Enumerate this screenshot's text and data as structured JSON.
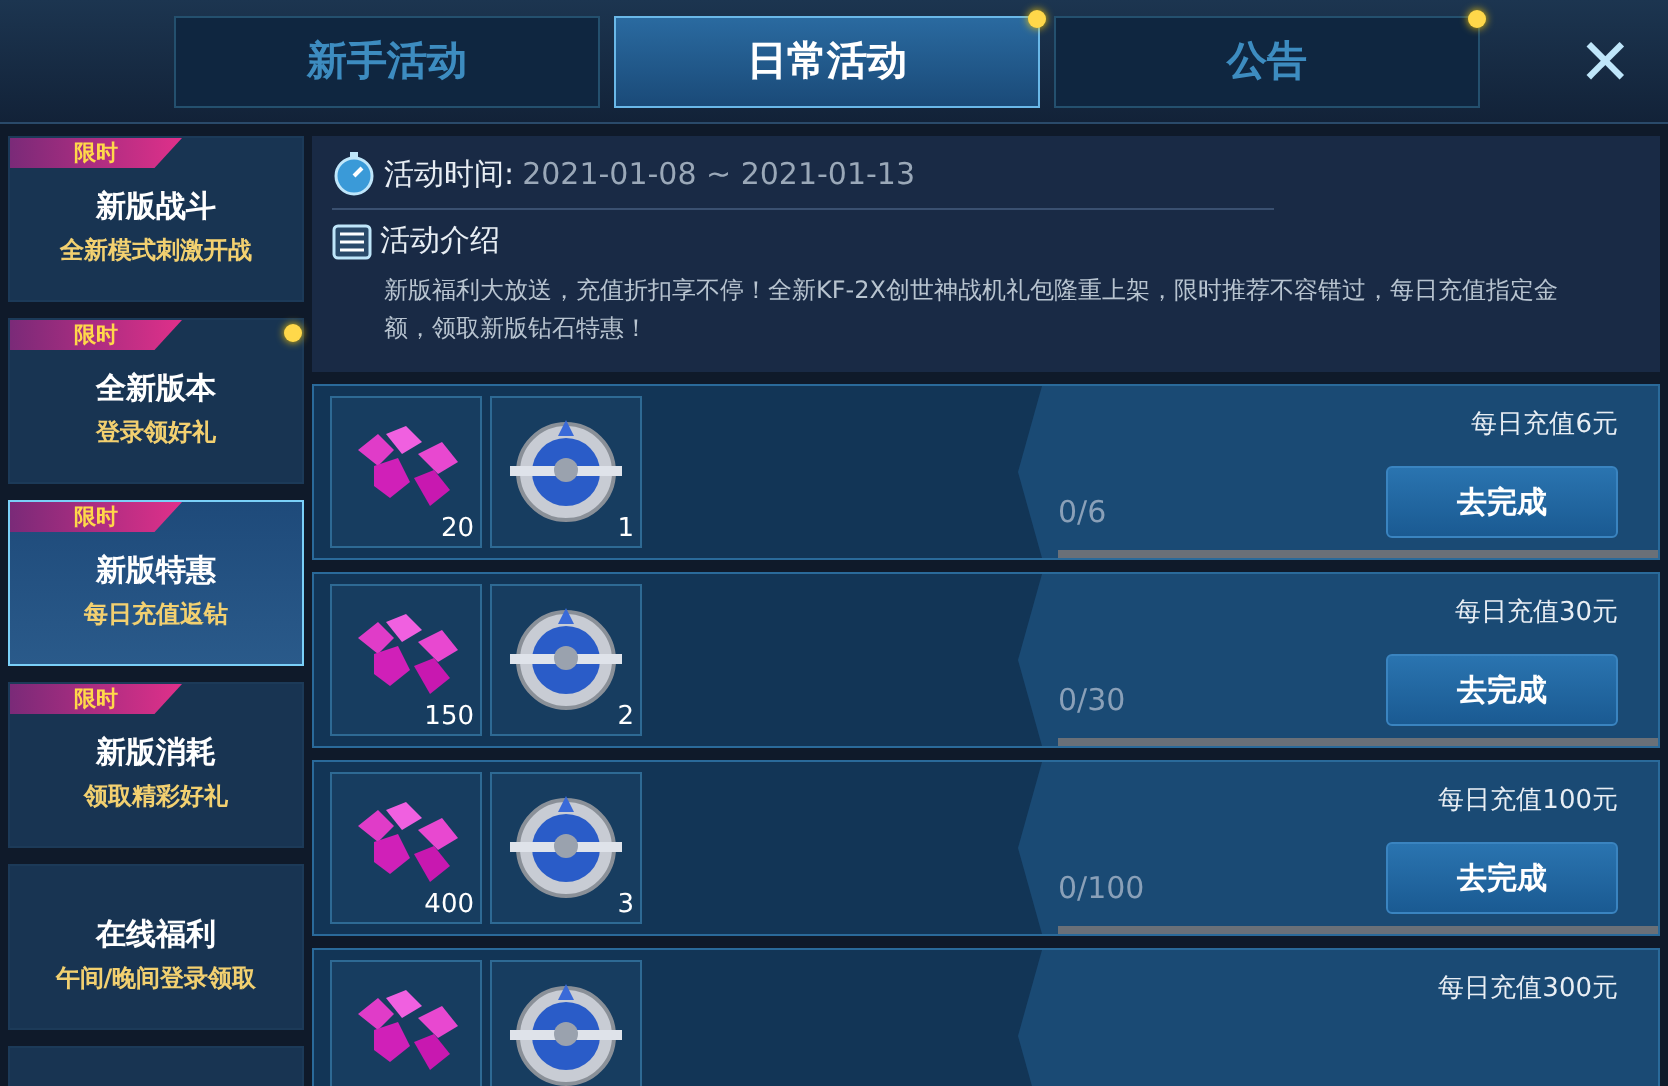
{
  "tabs": [
    {
      "label": "新手活动",
      "selected": false,
      "dot": false
    },
    {
      "label": "日常活动",
      "selected": true,
      "dot": true
    },
    {
      "label": "公告",
      "selected": false,
      "dot": true
    }
  ],
  "close": "✕",
  "sidebar": {
    "items": [
      {
        "title": "新版战斗",
        "subtitle": "全新模式刺激开战",
        "badge": "限时",
        "selected": false,
        "dot": false
      },
      {
        "title": "全新版本",
        "subtitle": "登录领好礼",
        "badge": "限时",
        "selected": false,
        "dot": true
      },
      {
        "title": "新版特惠",
        "subtitle": "每日充值返钻",
        "badge": "限时",
        "selected": true,
        "dot": false
      },
      {
        "title": "新版消耗",
        "subtitle": "领取精彩好礼",
        "badge": "限时",
        "selected": false,
        "dot": false
      },
      {
        "title": "在线福利",
        "subtitle": "午间/晚间登录领取",
        "selected": false,
        "dot": false
      }
    ]
  },
  "activity": {
    "time_label": "活动时间:",
    "time_value": "2021-01-08 ~ 2021-01-13",
    "intro_title": "活动介绍",
    "intro_text": "新版福利大放送，充值折扣享不停！全新KF-2X创世神战机礼包隆重上架，限时推荐不容错过，每日充值指定金额，领取新版钻石特惠！"
  },
  "tasks": [
    {
      "rewards": [
        {
          "kind": "gems",
          "count": "20"
        },
        {
          "kind": "badge",
          "count": "1"
        }
      ],
      "requirement": "每日充值6元",
      "progress": "0/6",
      "level": 0,
      "button": "去完成"
    },
    {
      "rewards": [
        {
          "kind": "gems",
          "count": "150"
        },
        {
          "kind": "badge",
          "count": "2"
        }
      ],
      "requirement": "每日充值30元",
      "progress": "0/30",
      "level": 0,
      "button": "去完成"
    },
    {
      "rewards": [
        {
          "kind": "gems",
          "count": "400"
        },
        {
          "kind": "badge",
          "count": "3"
        }
      ],
      "requirement": "每日充值100元",
      "progress": "0/100",
      "level": 0,
      "button": "去完成"
    },
    {
      "rewards": [
        {
          "kind": "gems"
        },
        {
          "kind": "badge"
        }
      ],
      "requirement": "每日充值300元"
    }
  ]
}
